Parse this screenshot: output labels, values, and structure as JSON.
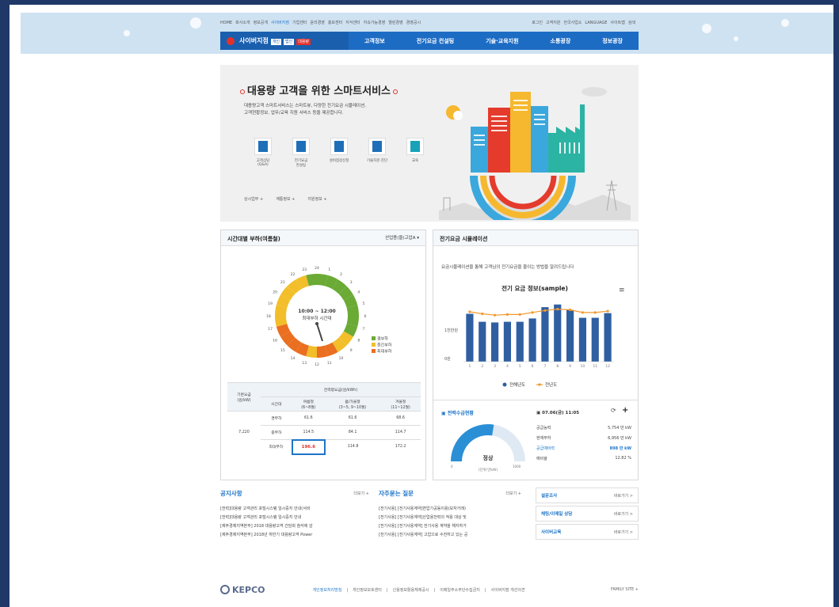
{
  "util": {
    "left": [
      "HOME",
      "회사소개",
      "정보공개",
      "사이버지점",
      "기업센터",
      "윤리경영",
      "홍보센터",
      "지식센터",
      "지속가능경영",
      "열린경영",
      "경영공시"
    ],
    "active_index": 3,
    "right": [
      "로그인",
      "고객지원",
      "전국사업소",
      "LANGUAGE",
      "사이트맵",
      "검색"
    ]
  },
  "gnb": {
    "cyber_label": "사이버지점",
    "chips": [
      "개인",
      "법인",
      "대용량"
    ],
    "chip_active": 2,
    "menu": [
      "고객정보",
      "전기요금 컨설팅",
      "기술·교육지원",
      "소통광장",
      "정보광장"
    ]
  },
  "hero": {
    "title": "대용량 고객을 위한 스마트서비스",
    "desc_lines": [
      "대용량고객 스마트서비스는 스마트뷰, 다양한 전기요금 시뮬레이션,",
      "고객현황정보, 업무/교육 지원 서비스 등을 제공합니다."
    ],
    "services": [
      {
        "label1": "고객상담",
        "label2": "(Q&A)",
        "icon": "chat-book-icon"
      },
      {
        "label1": "전기요금",
        "label2": "컨설팅",
        "icon": "pencil-doc-icon"
      },
      {
        "label1": "설비점검신청",
        "label2": "",
        "icon": "inspection-doc-icon"
      },
      {
        "label1": "기술자문·진단",
        "label2": "",
        "icon": "technical-doc-icon"
      },
      {
        "label1": "교육",
        "label2": "",
        "icon": "education-doc-icon"
      }
    ],
    "links": [
      "상시업무 +",
      "계통정보 +",
      "지원정보 +"
    ]
  },
  "load_panel": {
    "title": "시간대별 부하(여름철)",
    "select": "산업용(을)고압A",
    "center_time": "10:00 ~ 12:00",
    "center_label": "최대부하 시간대",
    "hours": [
      "24",
      "1",
      "2",
      "3",
      "4",
      "5",
      "6",
      "7",
      "8",
      "9",
      "10",
      "11",
      "12",
      "13",
      "14",
      "15",
      "16",
      "17",
      "18",
      "19",
      "20",
      "21",
      "22",
      "23"
    ],
    "legend": [
      {
        "label": "경부하",
        "color": "#6aaa35"
      },
      {
        "label": "중간부하",
        "color": "#f2be2a"
      },
      {
        "label": "최대부하",
        "color": "#ea6f20"
      }
    ],
    "table": {
      "col_base": "기본요금\n(원/kW)",
      "group": "전력량요금(원/kWh)",
      "col_time": "시간대",
      "seasons": [
        [
          "여름철",
          "(6~8월)"
        ],
        [
          "봄/가을철",
          "(3~5, 9~10월)"
        ],
        [
          "겨울철",
          "(11~12월)"
        ]
      ],
      "base_value": "7,220",
      "rows": [
        {
          "name": "경부하",
          "values": [
            "61.6",
            "61.6",
            "68.6"
          ]
        },
        {
          "name": "중부하",
          "values": [
            "114.5",
            "84.1",
            "114.7"
          ]
        },
        {
          "name": "최대부하",
          "values": [
            "196.6",
            "114.8",
            "172.2"
          ]
        }
      ]
    }
  },
  "sim_panel": {
    "title": "전기요금 시뮬레이션",
    "desc": "요금시뮬레이션을 통해 고객님의 전기요금을 줄이는 방법을 알려드립니다",
    "chart_title": "전기 요금 정보(sample)",
    "y_label": "1천만원",
    "y_zero": "0원",
    "legend_bar": "전해년도",
    "legend_line": "전년도",
    "supply_title": "전력수급현황",
    "supply_status": "정상",
    "supply_unit": "(단위:만kW)",
    "gauge_min": "0",
    "gauge_max": "1000",
    "gauge_level": 0.55,
    "datetime": "07.06(금) 11:05",
    "supply_rows": [
      {
        "label": "공급능력",
        "value": "5,754 만 kW"
      },
      {
        "label": "현재부하",
        "value": "6,956 만 kW"
      },
      {
        "label": "공급예비력",
        "value": "898 만 kW"
      },
      {
        "label": "예비율",
        "value": "12.82 %"
      }
    ]
  },
  "chart_data": {
    "type": "bar",
    "title": "전기 요금 정보(sample)",
    "categories": [
      "1",
      "2",
      "3",
      "4",
      "5",
      "6",
      "7",
      "8",
      "9",
      "10",
      "11",
      "12"
    ],
    "series": [
      {
        "name": "전해년도",
        "type": "bar",
        "values": [
          0.72,
          0.6,
          0.59,
          0.6,
          0.6,
          0.65,
          0.82,
          0.86,
          0.78,
          0.66,
          0.66,
          0.73
        ]
      },
      {
        "name": "전년도",
        "type": "line",
        "values": [
          0.75,
          0.72,
          0.7,
          0.71,
          0.71,
          0.74,
          0.77,
          0.79,
          0.78,
          0.74,
          0.74,
          0.76
        ]
      }
    ],
    "ylabel": "",
    "colors": {
      "bar": "#2f5fa1",
      "line": "#f29a2e"
    }
  },
  "notice": {
    "title": "공지사항",
    "more": "더보기 +",
    "items": [
      "[전력]대용량 고객관리 포털시스템 일시중지 안내(서비",
      "[전력]대용량 고객관리 포털시스템 일시중지 안내",
      "[제주경제지역본부] 2018 대용량고객 간담회 참석에 감",
      "[제주경제지역본부] 2018년 하반기 대용량고객 Power"
    ]
  },
  "faq": {
    "title": "자주묻는 질문",
    "more": "더보기 +",
    "items": [
      "[전기사용] [전기사용계약]변압기공동이용(모자거래)",
      "[전기사용] [전기사용계약]산업용전력의 적용 대상 및",
      "[전기사용] [전기사용계약] 전기사용 계약을 해지하거",
      "[전기사용] [전기사용계약] 고압으로 수전하고 있는 공"
    ]
  },
  "quick": [
    {
      "label": "설문조사",
      "go": "바로가기 >"
    },
    {
      "label": "채팅/이메일 상담",
      "go": "바로가기 >"
    },
    {
      "label": "사이버교육",
      "go": "바로가기 >"
    }
  ],
  "footer": {
    "brand": "KEPCO",
    "links": [
      "개인정보처리방침",
      "개인정보보호센터",
      "신용정보활용체제공시",
      "이메일주소무단수집금지",
      "사이버지점 개선의견"
    ],
    "family": "FAMILY SITE +"
  }
}
